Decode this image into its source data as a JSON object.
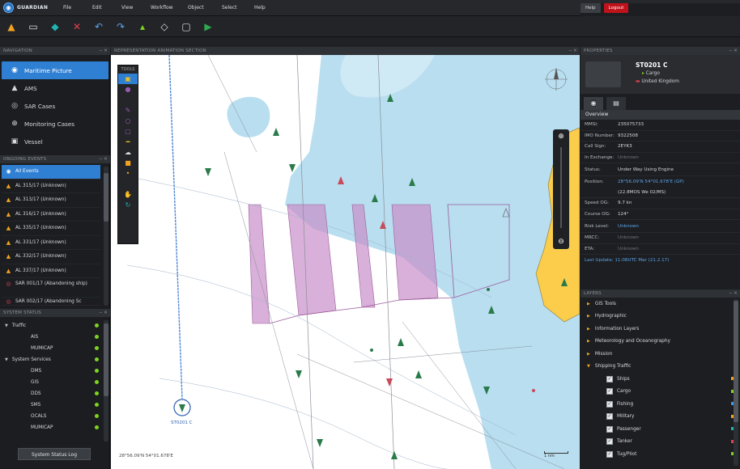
{
  "app": {
    "brand": "GUARDIAN",
    "menu": [
      "File",
      "Edit",
      "View",
      "Workflow",
      "Object",
      "Select",
      "Help"
    ],
    "help_label": "Help",
    "logout_label": "Logout"
  },
  "navigation": {
    "header": "NAVIGATION",
    "items": [
      {
        "label": "Maritime Picture",
        "icon": "globe-icon"
      },
      {
        "label": "AMS",
        "icon": "ship-icon"
      },
      {
        "label": "SAR Cases",
        "icon": "lifebuoy-icon"
      },
      {
        "label": "Monitoring Cases",
        "icon": "target-icon"
      },
      {
        "label": "Vessel",
        "icon": "vessel-icon"
      }
    ]
  },
  "alerts": {
    "header": "ONGOING EVENTS",
    "items": [
      {
        "label": "All Events",
        "kind": "all"
      },
      {
        "label": "AL 315/17 (Unknown)",
        "kind": "warn"
      },
      {
        "label": "AL 313/17 (Unknown)",
        "kind": "warn"
      },
      {
        "label": "AL 316/17 (Unknown)",
        "kind": "warn"
      },
      {
        "label": "AL 335/17 (Unknown)",
        "kind": "warn"
      },
      {
        "label": "AL 331/17 (Unknown)",
        "kind": "warn"
      },
      {
        "label": "AL 332/17 (Unknown)",
        "kind": "warn"
      },
      {
        "label": "AL 337/17 (Unknown)",
        "kind": "warn"
      },
      {
        "label": "SAR 001/17 (Abandoning ship)",
        "kind": "sar"
      },
      {
        "label": "SAR 002/17 (Abandoning Sc",
        "kind": "sar"
      }
    ]
  },
  "system_status": {
    "header": "SYSTEM STATUS",
    "groups": [
      {
        "label": "Traffic",
        "children": [
          "AIS",
          "MUMICAP"
        ]
      },
      {
        "label": "System Services",
        "children": [
          "DMS",
          "GIS",
          "DDS",
          "SMS",
          "OCALS",
          "MUMICAP"
        ]
      }
    ],
    "log_button": "System Status Log"
  },
  "map": {
    "header": "REPRESENTATION ANIMATION SECTION",
    "tools_label": "TOOLS",
    "coordinates": "28°56.09'N 54°01.678'E",
    "scale_label": "1 nm",
    "selected_track_label": "ST0201 C",
    "colors": {
      "water": "#b8def0",
      "deep": "#ffffff",
      "land": "#fccd4b",
      "zone": "#c98ec9"
    }
  },
  "properties": {
    "header": "PROPERTIES",
    "vessel_name": "ST0201 C",
    "vessel_type": "Cargo",
    "vessel_flag": "United Kingdom",
    "section": "Overview",
    "rows": [
      {
        "k": "MMSI:",
        "v": "235075733",
        "style": ""
      },
      {
        "k": "IMO Number:",
        "v": "9322508",
        "style": ""
      },
      {
        "k": "Call Sign:",
        "v": "2EYK3",
        "style": ""
      },
      {
        "k": "In Exchange:",
        "v": "Unknown",
        "style": "dim"
      },
      {
        "k": "Status:",
        "v": "Under Way Using Engine",
        "style": ""
      },
      {
        "k": "Position:",
        "v": "28°56.09'N 54°01.678'E (GP)",
        "style": "link"
      },
      {
        "k": "",
        "v": "(22.8MOS We 02/MS)",
        "style": ""
      },
      {
        "k": "Speed OG:",
        "v": "9.7 kn",
        "style": ""
      },
      {
        "k": "Course OG:",
        "v": "124°",
        "style": ""
      },
      {
        "k": "Risk Level:",
        "v": "Unknown",
        "style": "link"
      },
      {
        "k": "MRCC:",
        "v": "Unknown",
        "style": "dim"
      },
      {
        "k": "ETA:",
        "v": "Unknown",
        "style": "dim"
      }
    ],
    "footer_link": "Last Update: 11:08UTC Mar (21.2.17)"
  },
  "layers": {
    "header": "LAYERS",
    "groups": [
      "GIS Tools",
      "Hydrographic",
      "Information Layers",
      "Meteorology and Oceanography",
      "Mission",
      "Shipping Traffic"
    ],
    "traffic": [
      {
        "label": "Ships",
        "color": "#f0a320"
      },
      {
        "label": "Cargo",
        "color": "#7ed321"
      },
      {
        "label": "Fishing",
        "color": "#3a9be0"
      },
      {
        "label": "Military",
        "color": "#f0a320"
      },
      {
        "label": "Passenger",
        "color": "#1fb4b0"
      },
      {
        "label": "Tanker",
        "color": "#e2414f"
      },
      {
        "label": "Tug/Pilot",
        "color": "#7ed321"
      }
    ]
  }
}
